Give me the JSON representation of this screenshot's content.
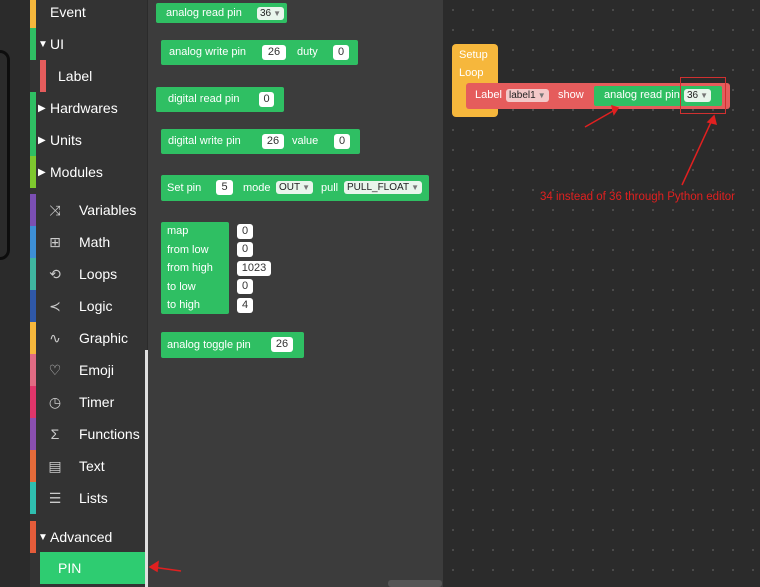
{
  "sidebar": {
    "items": [
      {
        "label": "Event",
        "color": "#f6b73c"
      },
      {
        "label": "UI",
        "color": "#2fbf63",
        "expanded": true
      },
      {
        "label": "Label",
        "color": "#e55c5c"
      },
      {
        "label": "Hardwares",
        "color": "#2fbf63"
      },
      {
        "label": "Units",
        "color": "#2fbf63"
      },
      {
        "label": "Modules",
        "color": "#7ec82e"
      },
      {
        "label": "Variables",
        "color": "#7b4fb3",
        "icon": "shuffle-icon"
      },
      {
        "label": "Math",
        "color": "#3d8fd6",
        "icon": "calculator-icon"
      },
      {
        "label": "Loops",
        "color": "#3fb6a0",
        "icon": "loop-icon"
      },
      {
        "label": "Logic",
        "color": "#2f58a8",
        "icon": "logic-icon"
      },
      {
        "label": "Graphic",
        "color": "#f6b73c",
        "icon": "graphic-icon"
      },
      {
        "label": "Emoji",
        "color": "#e06b83",
        "icon": "heart-icon"
      },
      {
        "label": "Timer",
        "color": "#e0356a",
        "icon": "clock-icon"
      },
      {
        "label": "Functions",
        "color": "#8a4fb0",
        "icon": "sigma-icon"
      },
      {
        "label": "Text",
        "color": "#e56b3a",
        "icon": "text-icon"
      },
      {
        "label": "Lists",
        "color": "#2fbfb0",
        "icon": "list-icon"
      },
      {
        "label": "Advanced",
        "color": "#e55c3a",
        "expanded": true
      },
      {
        "label": "PIN",
        "color": "#2ecc71",
        "selected": true
      }
    ]
  },
  "flyout": {
    "analog_read": {
      "label": "analog read pin",
      "pin": "36"
    },
    "analog_write": {
      "label": "analog write pin",
      "pin": "26",
      "duty_label": "duty",
      "duty": "0"
    },
    "digital_read": {
      "label": "digital read pin",
      "pin": "0"
    },
    "digital_write": {
      "label": "digital write pin",
      "pin": "26",
      "value_label": "value",
      "value": "0"
    },
    "set_pin": {
      "label": "Set pin",
      "pin": "5",
      "mode_label": "mode",
      "mode": "OUT",
      "pull_label": "pull",
      "pull": "PULL_FLOAT"
    },
    "map": {
      "label": "map",
      "map_val": "0",
      "from_low_label": "from low",
      "from_low": "0",
      "from_high_label": "from high",
      "from_high": "1023",
      "to_low_label": "to low",
      "to_low": "0",
      "to_high_label": "to high",
      "to_high": "4"
    },
    "toggle": {
      "label": "analog toggle pin",
      "pin": "26"
    }
  },
  "workspace": {
    "setup_label": "Setup",
    "loop_label": "Loop",
    "label_block": {
      "label": "Label",
      "name": "label1",
      "show": "show"
    },
    "inner_read": {
      "label": "analog read pin",
      "pin": "36"
    },
    "annotation": "34 instead of 36 through Python editor",
    "annotation_color": "#e02020"
  }
}
